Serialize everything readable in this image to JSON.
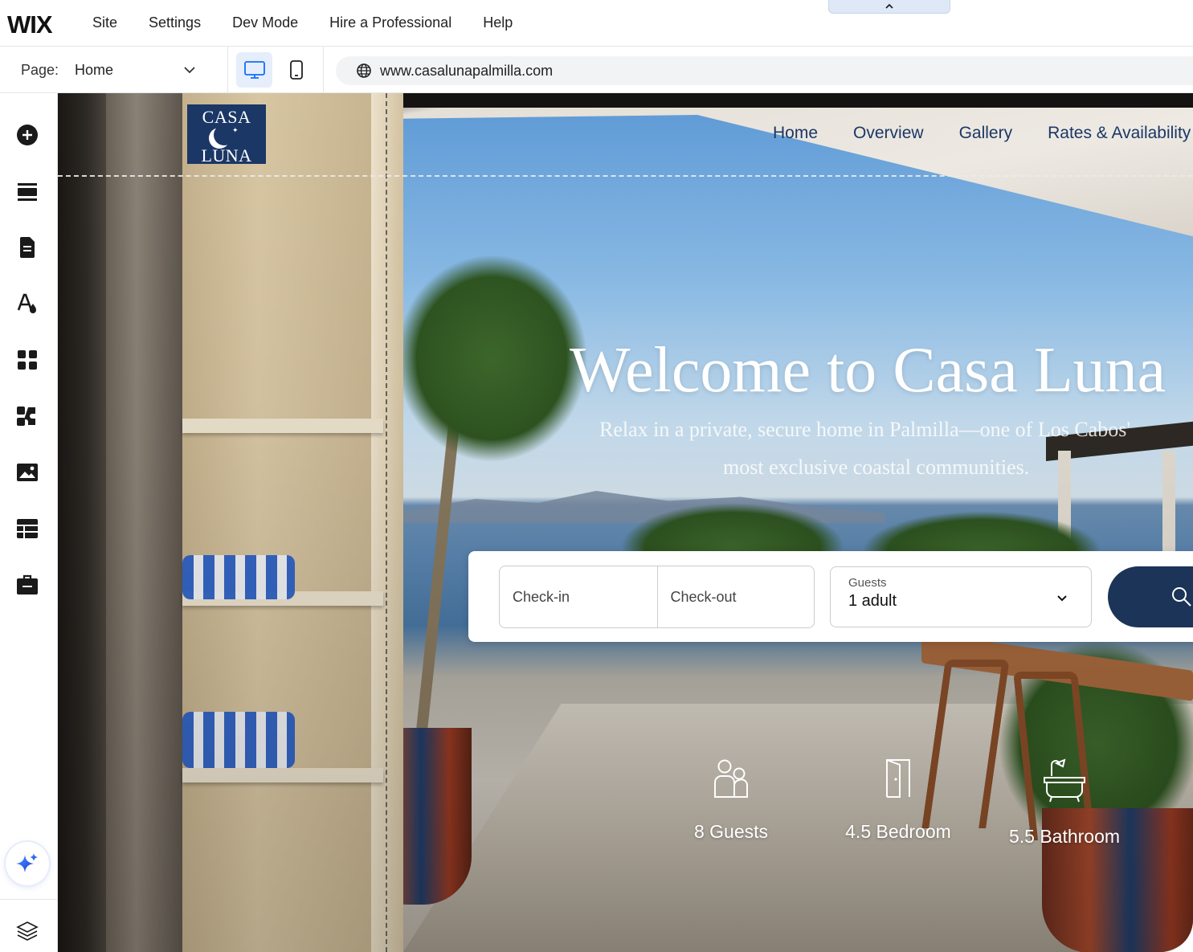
{
  "app": {
    "logo": "WIX",
    "menu": [
      "Site",
      "Settings",
      "Dev Mode",
      "Hire a Professional",
      "Help"
    ]
  },
  "pagebar": {
    "page_label": "Page:",
    "page_value": "Home",
    "url": "www.casalunapalmilla.com",
    "active_device": "desktop"
  },
  "sidebar": {
    "tools": [
      "add-elements-icon",
      "sections-icon",
      "pages-icon",
      "site-design-icon",
      "apps-icon",
      "add-ons-icon",
      "media-icon",
      "cms-icon",
      "business-tools-icon"
    ],
    "ai_assistant": "ai-sparkle-icon",
    "layers": "layers-icon"
  },
  "site": {
    "logo": {
      "line1": "CASA",
      "line2": "LUNA"
    },
    "nav": [
      "Home",
      "Overview",
      "Gallery",
      "Rates & Availability"
    ],
    "hero": {
      "title": "Welcome to Casa Luna",
      "subtitle_line1": "Relax in a private, secure home in Palmilla—one of Los Cabos'",
      "subtitle_line2": "most exclusive coastal communities."
    },
    "booking": {
      "checkin": "Check-in",
      "checkout": "Check-out",
      "guests_label": "Guests",
      "guests_value": "1 adult"
    },
    "amenities": [
      {
        "icon": "guests-icon",
        "label": "8 Guests"
      },
      {
        "icon": "door-icon",
        "label": "4.5 Bedroom"
      },
      {
        "icon": "bathtub-icon",
        "label": "5.5 Bathroom"
      }
    ]
  },
  "colors": {
    "brand_navy": "#1b3766",
    "search_button": "#1b3458",
    "editor_accent": "#116dff"
  }
}
